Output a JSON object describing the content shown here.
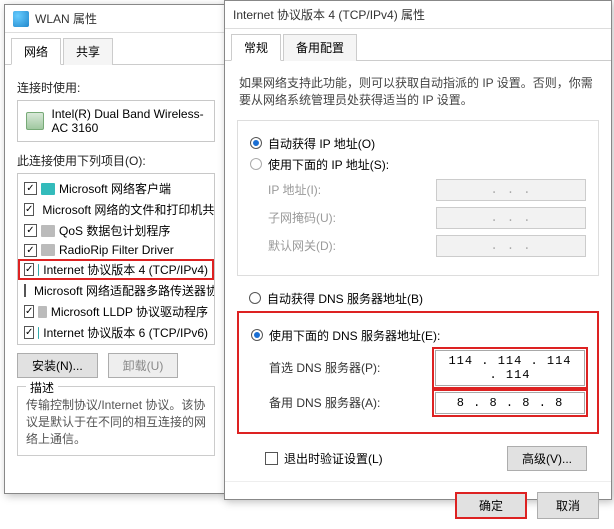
{
  "wlan": {
    "title": "WLAN 属性",
    "tabs": {
      "network": "网络",
      "sharing": "共享"
    },
    "connect_using": "连接时使用:",
    "adapter": "Intel(R) Dual Band Wireless-AC 3160",
    "items_label": "此连接使用下列项目(O):",
    "items": [
      {
        "checked": true,
        "label": "Microsoft 网络客户端"
      },
      {
        "checked": true,
        "label": "Microsoft 网络的文件和打印机共享"
      },
      {
        "checked": true,
        "label": "QoS 数据包计划程序"
      },
      {
        "checked": true,
        "label": "RadioRip Filter Driver"
      },
      {
        "checked": true,
        "label": "Internet 协议版本 4 (TCP/IPv4)",
        "highlight": true
      },
      {
        "checked": false,
        "label": "Microsoft 网络适配器多路传送器协议"
      },
      {
        "checked": true,
        "label": "Microsoft LLDP 协议驱动程序"
      },
      {
        "checked": true,
        "label": "Internet 协议版本 6 (TCP/IPv6)"
      }
    ],
    "install_btn": "安装(N)...",
    "uninstall_btn": "卸载(U)",
    "desc_title": "描述",
    "desc_text": "传输控制协议/Internet 协议。该协议是默认于在不同的相互连接的网络上通信。"
  },
  "ipv4": {
    "title": "Internet 协议版本 4 (TCP/IPv4) 属性",
    "tabs": {
      "general": "常规",
      "alt": "备用配置"
    },
    "intro": "如果网络支持此功能，则可以获取自动指派的 IP 设置。否则，你需要从网络系统管理员处获得适当的 IP 设置。",
    "auto_ip": "自动获得 IP 地址(O)",
    "manual_ip": "使用下面的 IP 地址(S):",
    "ip_addr": "IP 地址(I):",
    "subnet": "子网掩码(U):",
    "gateway": "默认网关(D):",
    "ip_placeholder": ".       .       .",
    "auto_dns": "自动获得 DNS 服务器地址(B)",
    "manual_dns": "使用下面的 DNS 服务器地址(E):",
    "pref_dns": "首选 DNS 服务器(P):",
    "alt_dns": "备用 DNS 服务器(A):",
    "pref_dns_val": "114 . 114 . 114 . 114",
    "alt_dns_val": "8  .  8  .  8  .  8",
    "validate": "退出时验证设置(L)",
    "advanced": "高级(V)...",
    "ok": "确定",
    "cancel": "取消"
  }
}
